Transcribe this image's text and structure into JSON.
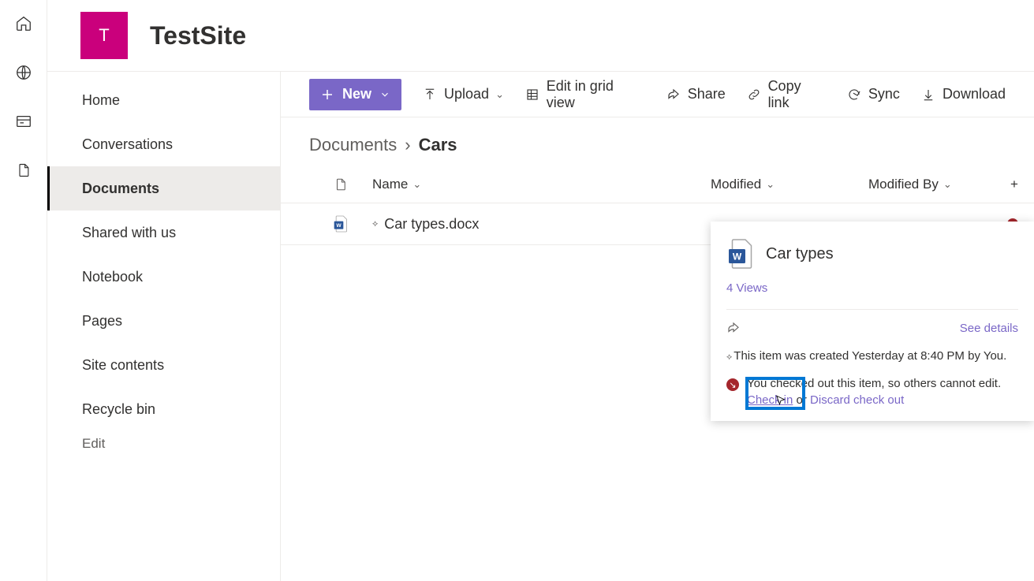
{
  "site": {
    "logoLetter": "T",
    "title": "TestSite"
  },
  "rail": {
    "home": "home-icon",
    "globe": "globe-icon",
    "news": "news-icon",
    "files": "files-icon"
  },
  "nav": {
    "items": [
      {
        "label": "Home"
      },
      {
        "label": "Conversations"
      },
      {
        "label": "Documents",
        "active": true
      },
      {
        "label": "Shared with us"
      },
      {
        "label": "Notebook"
      },
      {
        "label": "Pages"
      },
      {
        "label": "Site contents"
      },
      {
        "label": "Recycle bin"
      }
    ],
    "edit": "Edit"
  },
  "toolbar": {
    "newLabel": "New",
    "upload": "Upload",
    "editGrid": "Edit in grid view",
    "share": "Share",
    "copyLink": "Copy link",
    "sync": "Sync",
    "download": "Download"
  },
  "breadcrumb": {
    "parent": "Documents",
    "sep": "›",
    "current": "Cars"
  },
  "columns": {
    "name": "Name",
    "modified": "Modified",
    "modifiedBy": "Modified By"
  },
  "rows": [
    {
      "name": "Car types.docx"
    }
  ],
  "hoverCard": {
    "title": "Car types",
    "views": "4 Views",
    "seeDetails": "See details",
    "created": "This item was created Yesterday at 8:40 PM by You.",
    "checkout": {
      "msg": "You checked out this item, so others cannot edit.",
      "checkin": "Check in",
      "or": " or ",
      "discard": "Discard check out"
    }
  }
}
